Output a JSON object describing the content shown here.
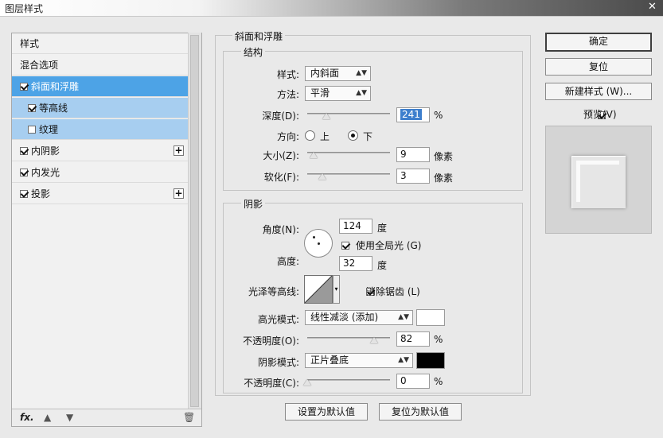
{
  "window": {
    "title": "图层样式"
  },
  "colors": {
    "selected": "#4da3e6",
    "sub_selected": "#a7cef0",
    "highlight_swatch": "#ffffff",
    "shadow_swatch": "#000000"
  },
  "styles": [
    {
      "label": "样式"
    },
    {
      "label": "混合选项"
    },
    {
      "label": "斜面和浮雕",
      "checked": true,
      "selected": true
    },
    {
      "label": "等高线",
      "checked": true,
      "sub": true
    },
    {
      "label": "纹理",
      "checked": false,
      "sub": true
    },
    {
      "label": "内阴影",
      "checked": true,
      "plus": true
    },
    {
      "label": "内发光",
      "checked": true
    },
    {
      "label": "投影",
      "checked": true,
      "plus": true
    }
  ],
  "bottom": {
    "fx": "fx."
  },
  "bevel": {
    "title": "斜面和浮雕",
    "structure": {
      "title": "结构",
      "style_label": "样式:",
      "style_value": "内斜面",
      "technique_label": "方法:",
      "technique_value": "平滑",
      "depth_label": "深度(D):",
      "depth_value": "241",
      "depth_unit": "%",
      "direction_label": "方向:",
      "dir_up": "上",
      "dir_down": "下",
      "size_label": "大小(Z):",
      "size_value": "9",
      "size_unit": "像素",
      "soften_label": "软化(F):",
      "soften_value": "3",
      "soften_unit": "像素"
    },
    "shading": {
      "title": "阴影",
      "angle_label": "角度(N):",
      "angle_value": "124",
      "angle_unit": "度",
      "global_light": "使用全局光 (G)",
      "altitude_label": "高度:",
      "altitude_value": "32",
      "altitude_unit": "度",
      "gloss_label": "光泽等高线:",
      "anti_alias": "消除锯齿 (L)",
      "highlight_mode_label": "高光模式:",
      "highlight_mode_value": "线性减淡 (添加)",
      "highlight_opacity_label": "不透明度(O):",
      "highlight_opacity_value": "82",
      "highlight_opacity_unit": "%",
      "shadow_mode_label": "阴影模式:",
      "shadow_mode_value": "正片叠底",
      "shadow_opacity_label": "不透明度(C):",
      "shadow_opacity_value": "0",
      "shadow_opacity_unit": "%"
    },
    "make_default": "设置为默认值",
    "reset_default": "复位为默认值"
  },
  "buttons": {
    "ok": "确定",
    "reset": "复位",
    "new_style": "新建样式 (W)...",
    "preview": "预览(V)"
  }
}
